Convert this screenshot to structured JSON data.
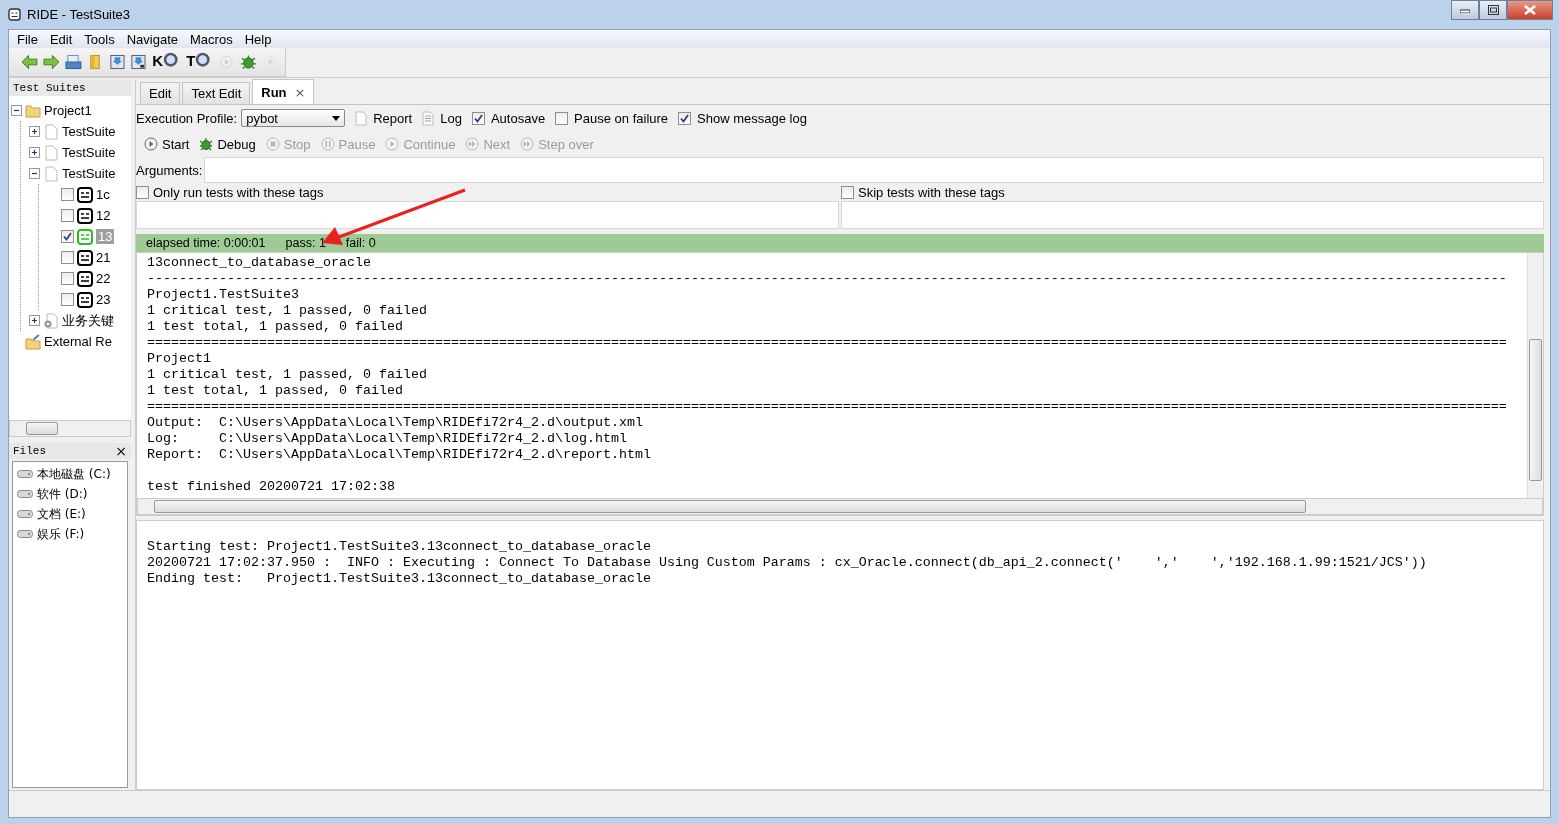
{
  "window": {
    "title": "RIDE - TestSuite3"
  },
  "menu": [
    "File",
    "Edit",
    "Tools",
    "Navigate",
    "Macros",
    "Help"
  ],
  "toolbar": [
    {
      "kind": "back"
    },
    {
      "kind": "forward"
    },
    {
      "kind": "open"
    },
    {
      "kind": "folder"
    },
    {
      "kind": "save"
    },
    {
      "kind": "saveall"
    },
    {
      "kind": "search",
      "label": "K"
    },
    {
      "kind": "search",
      "label": "T"
    },
    {
      "kind": "run",
      "disabled": true
    },
    {
      "kind": "debug"
    },
    {
      "kind": "stop",
      "disabled": true
    }
  ],
  "tree_panel": {
    "title": "Test Suites",
    "items": [
      {
        "label": "Project1",
        "kind": "folder",
        "expanded": true,
        "children": [
          {
            "label": "TestSuite",
            "kind": "suite",
            "expanded": false
          },
          {
            "label": "TestSuite",
            "kind": "suite",
            "expanded": false
          },
          {
            "label": "TestSuite",
            "kind": "suite",
            "expanded": true,
            "children": [
              {
                "label": "1c",
                "kind": "test",
                "checked": false,
                "selected": false,
                "passed": false
              },
              {
                "label": "12",
                "kind": "test",
                "checked": false,
                "selected": false,
                "passed": false
              },
              {
                "label": "13",
                "kind": "test",
                "checked": true,
                "selected": true,
                "passed": true
              },
              {
                "label": "21",
                "kind": "test",
                "checked": false,
                "selected": false,
                "passed": false
              },
              {
                "label": "22",
                "kind": "test",
                "checked": false,
                "selected": false,
                "passed": false
              },
              {
                "label": "23",
                "kind": "test",
                "checked": false,
                "selected": false,
                "passed": false
              }
            ]
          },
          {
            "label": "业务关键",
            "kind": "resource",
            "expanded": false
          }
        ]
      },
      {
        "label": "External Re",
        "kind": "external"
      }
    ]
  },
  "files_panel": {
    "title": "Files",
    "close": "×",
    "drives": [
      "本地磁盘 (C:)",
      "软件 (D:)",
      "文档 (E:)",
      "娱乐 (F:)"
    ]
  },
  "tabs": [
    {
      "label": "Edit",
      "selected": false
    },
    {
      "label": "Text Edit",
      "selected": false
    },
    {
      "label": "Run",
      "selected": true,
      "close": "×"
    }
  ],
  "run": {
    "profile_label": "Execution Profile:",
    "profile": "pybot",
    "links": [
      {
        "kind": "report",
        "label": "Report"
      },
      {
        "kind": "log",
        "label": "Log"
      }
    ],
    "options": [
      {
        "label": "Autosave",
        "checked": true
      },
      {
        "label": "Pause on failure",
        "checked": false
      },
      {
        "label": "Show message log",
        "checked": true
      }
    ],
    "buttons": [
      {
        "kind": "play",
        "label": "Start",
        "disabled": false
      },
      {
        "kind": "debug",
        "label": "Debug",
        "disabled": false
      },
      {
        "kind": "stop",
        "label": "Stop",
        "disabled": true
      },
      {
        "kind": "pause",
        "label": "Pause",
        "disabled": true
      },
      {
        "kind": "play",
        "label": "Continue",
        "disabled": true
      },
      {
        "kind": "next",
        "label": "Next",
        "disabled": true
      },
      {
        "kind": "next",
        "label": "Step over",
        "disabled": true
      }
    ],
    "arguments_label": "Arguments:",
    "tag_filters": [
      {
        "label": "Only run tests with these tags",
        "checked": false
      },
      {
        "label": "Skip tests with these tags",
        "checked": false
      }
    ],
    "status": {
      "elapsed": "elapsed time: 0:00:01",
      "pass": "pass: 1",
      "fail": "fail: 0",
      "passed": true
    }
  },
  "output_log": {
    "lines": [
      "13connect_to_database_oracle",
      "--------------------------------------------------------------------------------------------------------------------------------------------------------------------------",
      "Project1.TestSuite3",
      "1 critical test, 1 passed, 0 failed",
      "1 test total, 1 passed, 0 failed",
      "==========================================================================================================================================================================",
      "Project1",
      "1 critical test, 1 passed, 0 failed",
      "1 test total, 1 passed, 0 failed",
      "==========================================================================================================================================================================",
      "Output:  C:\\Users\\AppData\\Local\\Temp\\RIDEfi72r4_2.d\\output.xml",
      "Log:     C:\\Users\\AppData\\Local\\Temp\\RIDEfi72r4_2.d\\log.html",
      "Report:  C:\\Users\\AppData\\Local\\Temp\\RIDEfi72r4_2.d\\report.html"
    ],
    "finished": "test finished 20200721 17:02:38"
  },
  "message_log": {
    "lines": [
      "Starting test: Project1.TestSuite3.13connect_to_database_oracle",
      "20200721 17:02:37.950 :  INFO : Executing : Connect To Database Using Custom Params : cx_Oracle.connect(db_api_2.connect('    ','    ','192.168.1.99:1521/JCS'))",
      "Ending test:   Project1.TestSuite3.13connect_to_database_oracle"
    ]
  }
}
